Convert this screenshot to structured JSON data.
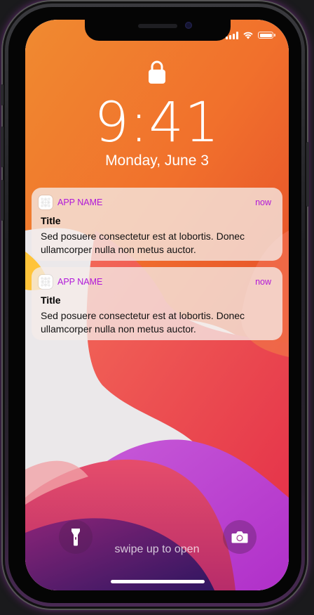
{
  "status_bar": {
    "signal_icon": "cellular-signal-icon",
    "wifi_icon": "wifi-icon",
    "battery_icon": "battery-icon"
  },
  "lock_screen": {
    "lock_icon": "lock-icon",
    "time": "9:41",
    "date": "Monday, June 3",
    "swipe_hint": "swipe up to open"
  },
  "notifications": [
    {
      "app_icon": "app-icon",
      "app_name": "APP NAME",
      "time": "now",
      "title": "Title",
      "body": "Sed posuere consectetur est at lobortis. Donec ullamcorper nulla non metus auctor."
    },
    {
      "app_icon": "app-icon",
      "app_name": "APP NAME",
      "time": "now",
      "title": "Title",
      "body": "Sed posuere consectetur est at lobortis. Donec ullamcorper nulla non metus auctor."
    }
  ],
  "controls": {
    "flashlight_icon": "flashlight-icon",
    "camera_icon": "camera-icon"
  },
  "colors": {
    "accent": "#b018d8",
    "wallpaper_orange": "#f37a2a",
    "wallpaper_red": "#e8383e",
    "wallpaper_purple": "#b63ad0",
    "wallpaper_deep": "#3a1560"
  }
}
